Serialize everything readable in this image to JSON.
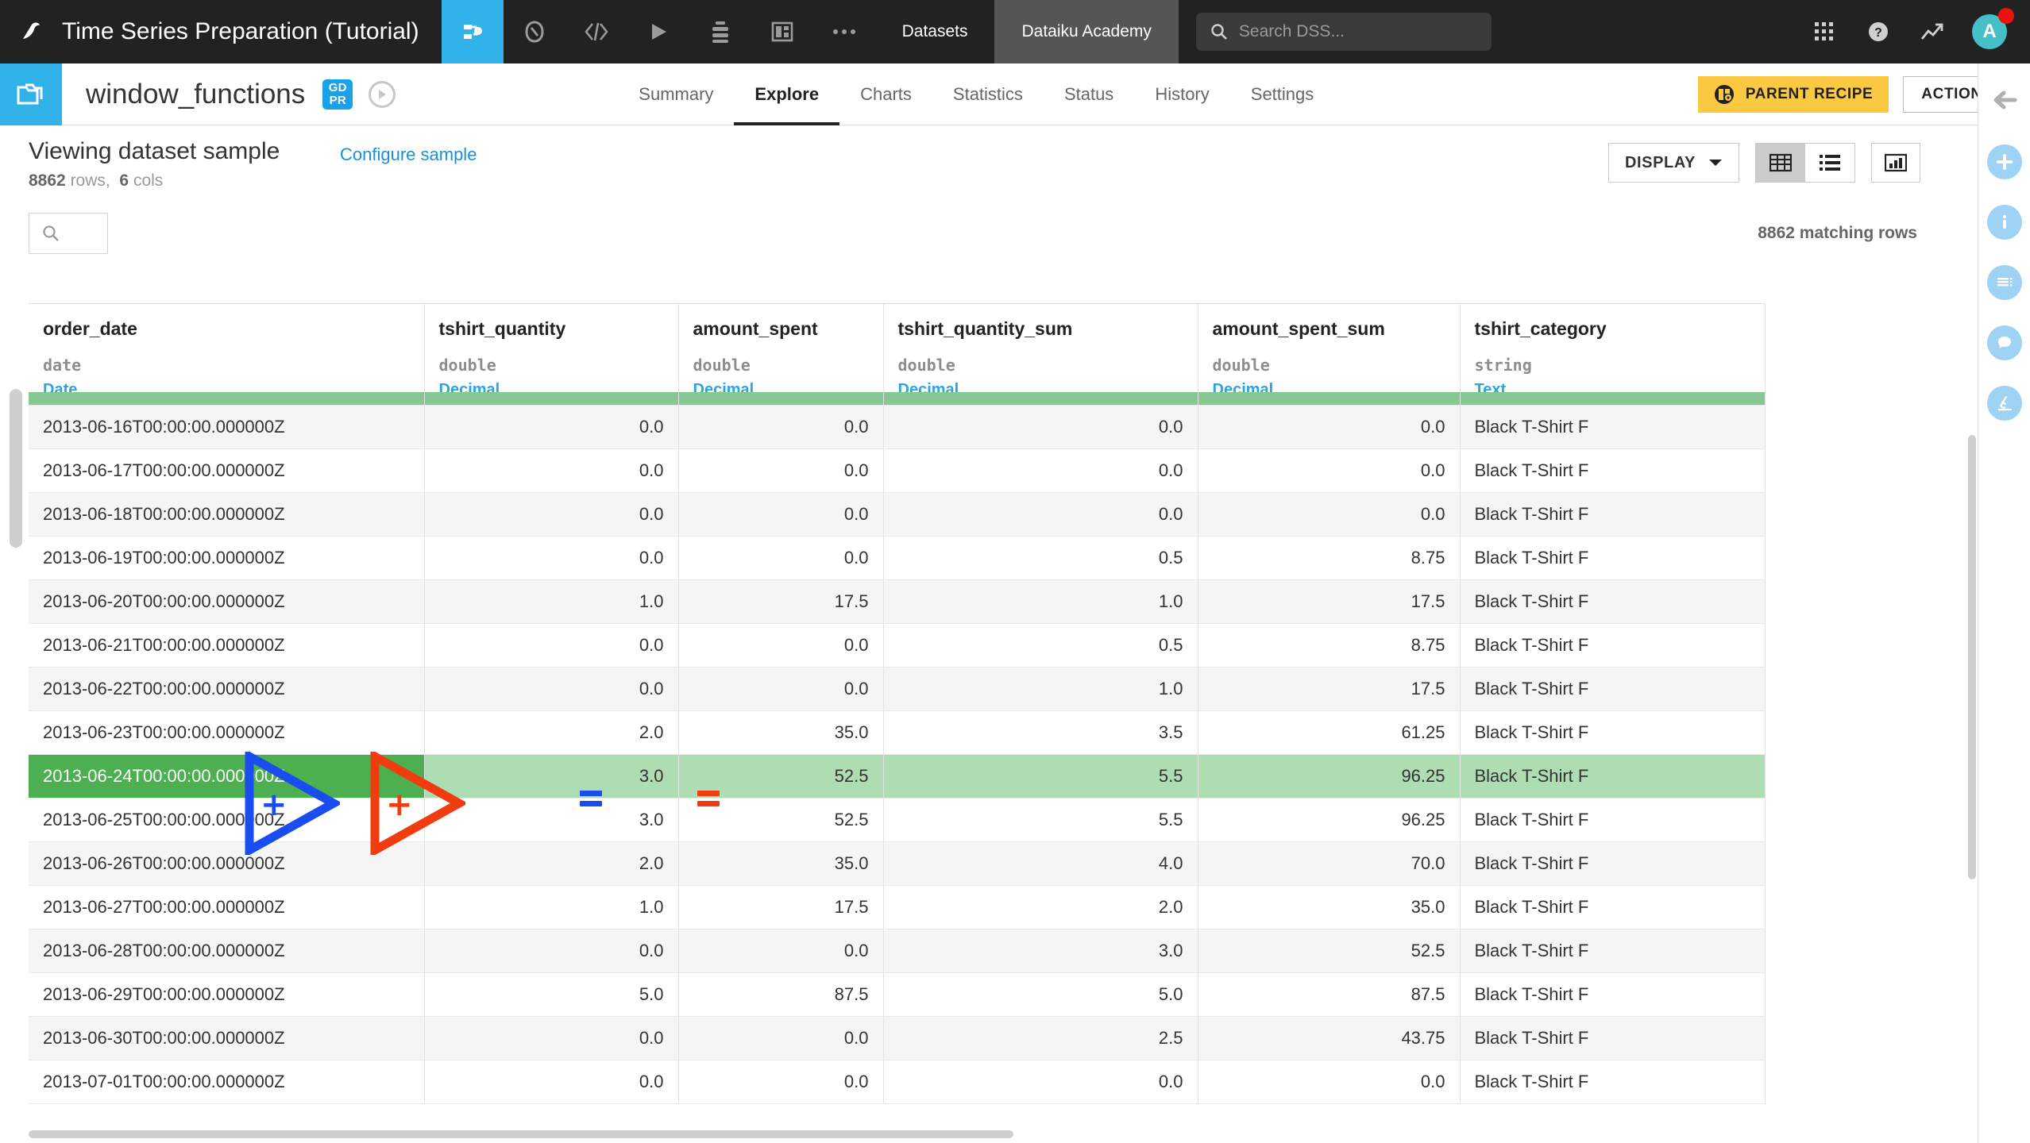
{
  "topnav": {
    "logo_icon": "dataiku-bird-logo",
    "project_title": "Time Series Preparation (Tutorial)",
    "icons": [
      {
        "name": "flow-icon",
        "active": true
      },
      {
        "name": "lab-icon",
        "active": false
      },
      {
        "name": "code-icon",
        "active": false
      },
      {
        "name": "jobs-play-icon",
        "active": false
      },
      {
        "name": "automation-icon",
        "active": false
      },
      {
        "name": "dashboard-icon",
        "active": false
      },
      {
        "name": "more-ellipsis-icon",
        "active": false
      }
    ],
    "datasets_label": "Datasets",
    "academy_label": "Dataiku Academy",
    "search_placeholder": "Search DSS...",
    "search_value": "",
    "search_icon": "search-icon",
    "apps_icon": "apps-grid-icon",
    "help_icon": "help-circle-icon",
    "trend_icon": "trending-up-icon",
    "avatar_initial": "A",
    "notification_color": "#e8140b"
  },
  "dataset_header": {
    "folder_icon": "dataset-folder-icon",
    "name": "window_functions",
    "gdpr_badge_line1": "GD",
    "gdpr_badge_line2": "PR",
    "compass_icon": "compass-icon",
    "tabs": [
      {
        "label": "Summary",
        "active": false
      },
      {
        "label": "Explore",
        "active": true
      },
      {
        "label": "Charts",
        "active": false
      },
      {
        "label": "Statistics",
        "active": false
      },
      {
        "label": "Status",
        "active": false
      },
      {
        "label": "History",
        "active": false
      },
      {
        "label": "Settings",
        "active": false
      }
    ],
    "parent_recipe_label": "PARENT RECIPE",
    "parent_recipe_icon": "recipe-icon",
    "parent_recipe_color": "#fac841",
    "actions_label": "ACTIONS"
  },
  "sample_bar": {
    "title": "Viewing dataset sample",
    "configure_link": "Configure sample",
    "rows_count": "8862",
    "rows_label": "rows,",
    "cols_count": "6",
    "cols_label": "cols",
    "display_label": "DISPLAY",
    "display_caret_icon": "chevron-down-icon",
    "view_table_icon": "table-view-icon",
    "view_list_icon": "list-view-icon",
    "view_chart_icon": "chart-view-icon"
  },
  "table_toolbar": {
    "search_icon": "search-icon",
    "search_value": "",
    "matching_rows": "8862 matching rows"
  },
  "table": {
    "columns": [
      {
        "name": "order_date",
        "type": "date",
        "meaning": "Date",
        "align": "txt"
      },
      {
        "name": "tshirt_quantity",
        "type": "double",
        "meaning": "Decimal",
        "align": "num"
      },
      {
        "name": "amount_spent",
        "type": "double",
        "meaning": "Decimal",
        "align": "num"
      },
      {
        "name": "tshirt_quantity_sum",
        "type": "double",
        "meaning": "Decimal",
        "align": "num"
      },
      {
        "name": "amount_spent_sum",
        "type": "double",
        "meaning": "Decimal",
        "align": "num"
      },
      {
        "name": "tshirt_category",
        "type": "string",
        "meaning": "Text",
        "align": "txt"
      }
    ],
    "quality_bar_color": "#83c991",
    "selected_row_index": 8,
    "rows": [
      [
        "2013-06-16T00:00:00.000000Z",
        "0.0",
        "0.0",
        "0.0",
        "0.0",
        "Black T-Shirt F"
      ],
      [
        "2013-06-17T00:00:00.000000Z",
        "0.0",
        "0.0",
        "0.0",
        "0.0",
        "Black T-Shirt F"
      ],
      [
        "2013-06-18T00:00:00.000000Z",
        "0.0",
        "0.0",
        "0.0",
        "0.0",
        "Black T-Shirt F"
      ],
      [
        "2013-06-19T00:00:00.000000Z",
        "0.0",
        "0.0",
        "0.5",
        "8.75",
        "Black T-Shirt F"
      ],
      [
        "2013-06-20T00:00:00.000000Z",
        "1.0",
        "17.5",
        "1.0",
        "17.5",
        "Black T-Shirt F"
      ],
      [
        "2013-06-21T00:00:00.000000Z",
        "0.0",
        "0.0",
        "0.5",
        "8.75",
        "Black T-Shirt F"
      ],
      [
        "2013-06-22T00:00:00.000000Z",
        "0.0",
        "0.0",
        "1.0",
        "17.5",
        "Black T-Shirt F"
      ],
      [
        "2013-06-23T00:00:00.000000Z",
        "2.0",
        "35.0",
        "3.5",
        "61.25",
        "Black T-Shirt F"
      ],
      [
        "2013-06-24T00:00:00.000000Z",
        "3.0",
        "52.5",
        "5.5",
        "96.25",
        "Black T-Shirt F"
      ],
      [
        "2013-06-25T00:00:00.000000Z",
        "3.0",
        "52.5",
        "5.5",
        "96.25",
        "Black T-Shirt F"
      ],
      [
        "2013-06-26T00:00:00.000000Z",
        "2.0",
        "35.0",
        "4.0",
        "70.0",
        "Black T-Shirt F"
      ],
      [
        "2013-06-27T00:00:00.000000Z",
        "1.0",
        "17.5",
        "2.0",
        "35.0",
        "Black T-Shirt F"
      ],
      [
        "2013-06-28T00:00:00.000000Z",
        "0.0",
        "0.0",
        "3.0",
        "52.5",
        "Black T-Shirt F"
      ],
      [
        "2013-06-29T00:00:00.000000Z",
        "5.0",
        "87.5",
        "5.0",
        "87.5",
        "Black T-Shirt F"
      ],
      [
        "2013-06-30T00:00:00.000000Z",
        "0.0",
        "0.0",
        "2.5",
        "43.75",
        "Black T-Shirt F"
      ],
      [
        "2013-07-01T00:00:00.000000Z",
        "0.0",
        "0.0",
        "0.0",
        "0.0",
        "Black T-Shirt F"
      ]
    ]
  },
  "annotations": {
    "blue_color": "#1a4df0",
    "red_color": "#f03c0f",
    "blue_plus": "+",
    "red_plus": "+",
    "blue_equals": "=",
    "red_equals": "="
  },
  "right_rail": {
    "collapse_icon": "arrow-left-collapse-icon",
    "items": [
      {
        "name": "add-icon"
      },
      {
        "name": "info-icon"
      },
      {
        "name": "details-icon"
      },
      {
        "name": "discussions-icon"
      },
      {
        "name": "lab-microscope-icon"
      }
    ],
    "icon_color": "#9ed3f5"
  }
}
